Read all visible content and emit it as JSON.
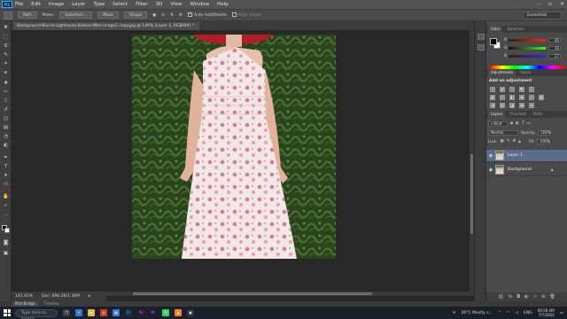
{
  "menubar": {
    "logo": "Ps",
    "items": [
      "File",
      "Edit",
      "Image",
      "Layer",
      "Type",
      "Select",
      "Filter",
      "3D",
      "View",
      "Window",
      "Help"
    ]
  },
  "options": {
    "path_mode": "Path",
    "make_label": "Make:",
    "selection_btn": "Selection...",
    "mask_btn": "Mask",
    "shape_btn": "Shape",
    "auto_add_delete": "Auto Add/Delete",
    "align_edges": "Align Edges",
    "workspace": "Essentials"
  },
  "document": {
    "tab_title": "Background-Blur-in-Lightroom-Before-After-image2 copy.jpg @ 146% (Layer 1, RGB/8#) *"
  },
  "status": {
    "zoom": "145.91%",
    "doc_size": "Doc: 696.2K/1.36M"
  },
  "bottom_tabs": [
    "Mini Bridge",
    "Timeline"
  ],
  "color_panel": {
    "tabs": [
      "Color",
      "Swatches"
    ],
    "rows": [
      {
        "label": "R",
        "value": "46"
      },
      {
        "label": "G",
        "value": "36"
      },
      {
        "label": "B",
        "value": "27"
      }
    ],
    "fg_color": "#000000",
    "bg_color": "#ffffff"
  },
  "adjustments_panel": {
    "tabs": [
      "Adjustments",
      "Styles"
    ],
    "title": "Add an adjustment"
  },
  "layers_panel": {
    "tabs": [
      "Layers",
      "Channels",
      "Paths"
    ],
    "kind_filter": "Kind",
    "blend_mode": "Normal",
    "opacity_label": "Opacity:",
    "opacity_value": "100%",
    "lock_label": "Lock:",
    "fill_label": "Fill:",
    "fill_value": "100%",
    "layers": [
      {
        "name": "Layer 1",
        "selected": true
      },
      {
        "name": "Background",
        "selected": false
      }
    ]
  },
  "taskbar": {
    "search_placeholder": "Type here to search",
    "weather": "26°C  Mostly s...",
    "language": "ENG",
    "time": "09:58 AM",
    "date": "7/7/2022"
  }
}
